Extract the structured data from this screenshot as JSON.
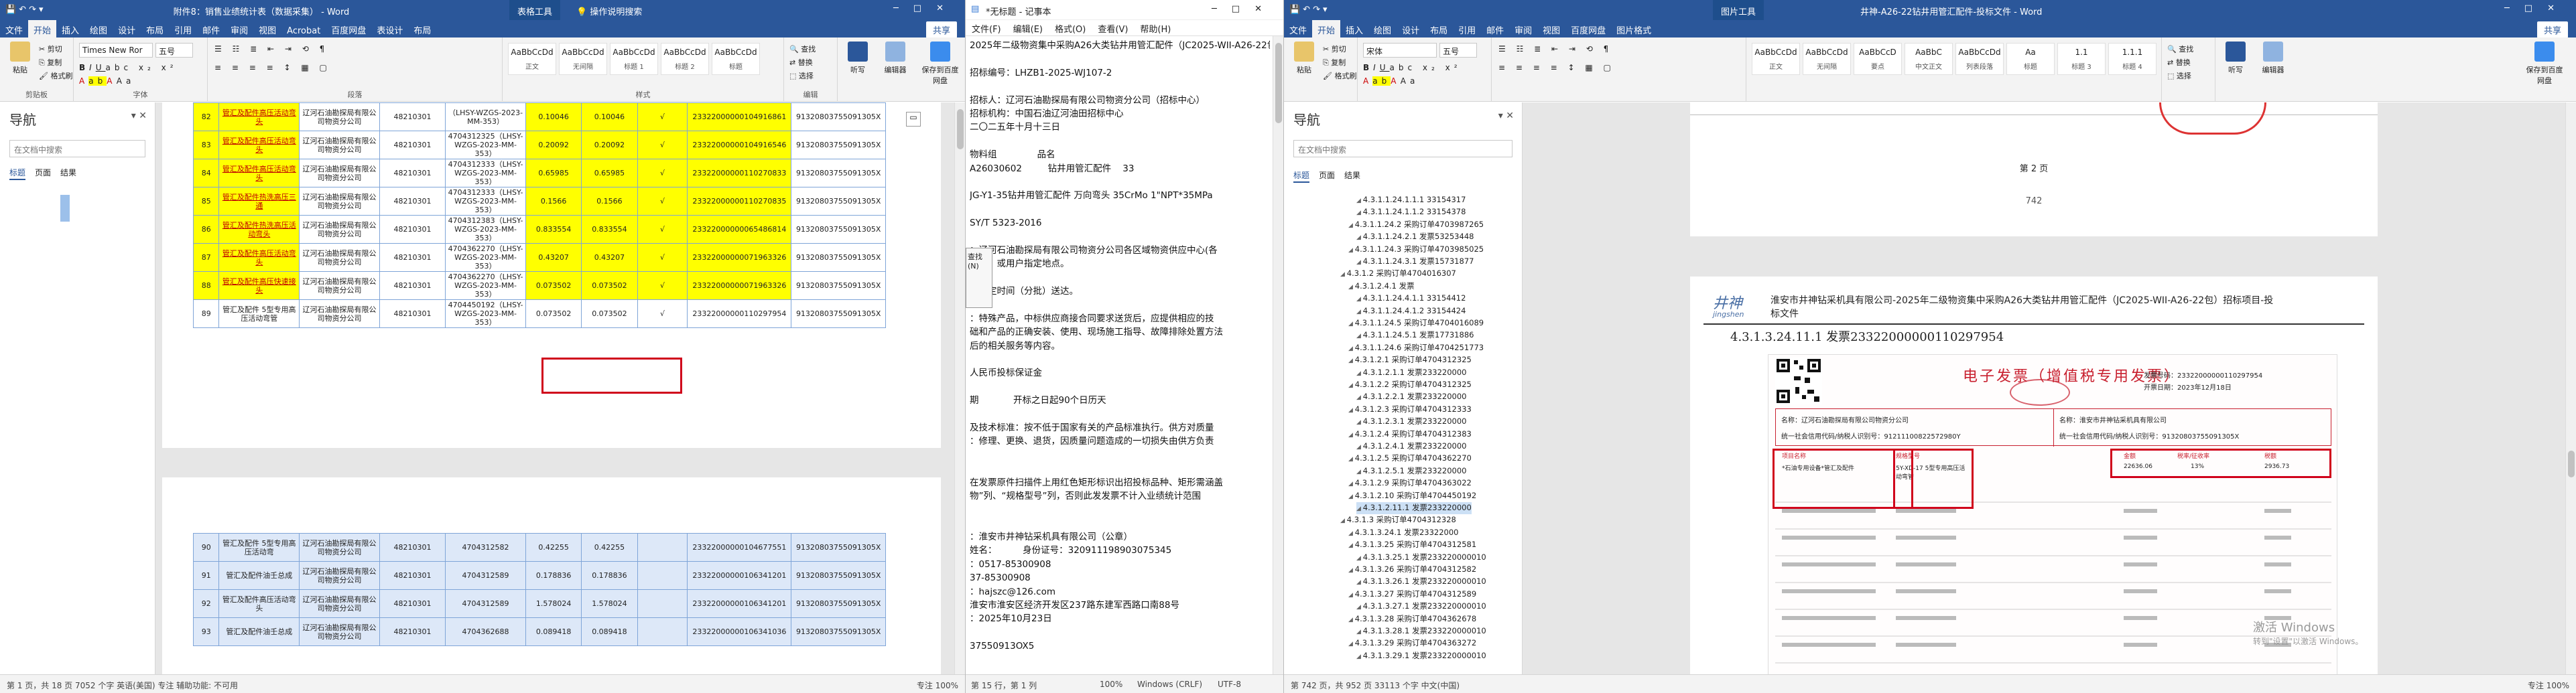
{
  "left_window": {
    "title": "附件8：销售业绩统计表（数据采集） - Word",
    "context_tab": "表格工具",
    "tell_me": "操作说明搜索",
    "share": "共享",
    "tabs": [
      "文件",
      "开始",
      "插入",
      "绘图",
      "设计",
      "布局",
      "引用",
      "邮件",
      "审阅",
      "视图",
      "Acrobat",
      "百度网盘",
      "表设计",
      "布局"
    ],
    "clipboard": {
      "paste": "粘贴",
      "cut": "剪切",
      "copy": "复制",
      "format_painter": "格式刷",
      "label": "剪贴板"
    },
    "font_name": "Times New Ror",
    "font_size": "五号",
    "font_label": "字体",
    "paragraph_label": "段落",
    "styles": [
      {
        "preview": "AaBbCcDd",
        "name": "正文"
      },
      {
        "preview": "AaBbCcDd",
        "name": "无间隔"
      },
      {
        "preview": "AaBbCcDd",
        "name": "标题 1"
      },
      {
        "preview": "AaBbCcDd",
        "name": "标题 2"
      },
      {
        "preview": "AaBbCcDd",
        "name": "标题"
      }
    ],
    "styles_label": "样式",
    "editing": {
      "find": "查找",
      "replace": "替换",
      "select": "选择",
      "label": "编辑"
    },
    "buttons": {
      "dictation": "听写",
      "label_voice": "语音",
      "editor": "编辑器",
      "sensitivity": "灵敏度",
      "save_baidu": "保存到百度网盘"
    },
    "nav": {
      "title": "导航",
      "search_placeholder": "在文档中搜索",
      "tabs": [
        "标题",
        "页面",
        "结果"
      ]
    },
    "table_rows": [
      {
        "no": "82",
        "name": "管汇及配件高压活动弯头",
        "org": "辽河石油勘探局有限公司物资分公司",
        "code": "48210301",
        "contract": "（LHSY-WZGS-2023-MM-353）",
        "p1": "0.10046",
        "p2": "0.10046",
        "mark": "√",
        "inv": "23322000000104916861",
        "tax": "91320803755091305X"
      },
      {
        "no": "83",
        "name": "管汇及配件高压活动弯头",
        "org": "辽河石油勘探局有限公司物资分公司",
        "code": "48210301",
        "contract": "4704312325（LHSY-WZGS-2023-MM-353）",
        "p1": "0.20092",
        "p2": "0.20092",
        "mark": "√",
        "inv": "23322000000104916546",
        "tax": "91320803755091305X"
      },
      {
        "no": "84",
        "name": "管汇及配件高压活动弯头",
        "org": "辽河石油勘探局有限公司物资分公司",
        "code": "48210301",
        "contract": "4704312333（LHSY-WZGS-2023-MM-353）",
        "p1": "0.65985",
        "p2": "0.65985",
        "mark": "√",
        "inv": "23322000000110270833",
        "tax": "91320803755091305X"
      },
      {
        "no": "85",
        "name": "管汇及配件热洗高压三通",
        "org": "辽河石油勘探局有限公司物资分公司",
        "code": "48210301",
        "contract": "4704312333（LHSY-WZGS-2023-MM-353）",
        "p1": "0.1566",
        "p2": "0.1566",
        "mark": "√",
        "inv": "23322000000110270835",
        "tax": "91320803755091305X"
      },
      {
        "no": "86",
        "name": "管汇及配件热洗高压活动弯头",
        "org": "辽河石油勘探局有限公司物资分公司",
        "code": "48210301",
        "contract": "4704312383（LHSY-WZGS-2023-MM-353）",
        "p1": "0.833554",
        "p2": "0.833554",
        "mark": "√",
        "inv": "23322000000065486814",
        "tax": "91320803755091305X"
      },
      {
        "no": "87",
        "name": "管汇及配件高压活动弯头",
        "org": "辽河石油勘探局有限公司物资分公司",
        "code": "48210301",
        "contract": "4704362270（LHSY-WZGS-2023-MM-353）",
        "p1": "0.43207",
        "p2": "0.43207",
        "mark": "√",
        "inv": "23322000000071963326",
        "tax": "91320803755091305X"
      },
      {
        "no": "88",
        "name": "管汇及配件高压快速接头",
        "org": "辽河石油勘探局有限公司物资分公司",
        "code": "48210301",
        "contract": "4704362270（LHSY-WZGS-2023-MM-353）",
        "p1": "0.073502",
        "p2": "0.073502",
        "mark": "√",
        "inv": "23322000000071963326",
        "tax": "91320803755091305X"
      },
      {
        "no": "89",
        "name": "管汇及配件 5型专用高压活动弯管",
        "org": "辽河石油勘探局有限公司物资分公司",
        "code": "48210301",
        "contract": "4704450192（LHSY-WZGS-2023-MM-353）",
        "p1": "0.073502",
        "p2": "0.073502",
        "mark": "√",
        "inv": "23322000000110297954",
        "tax": "91320803755091305X"
      }
    ],
    "table_rows2": [
      {
        "no": "90",
        "name": "管汇及配件 5型专用高压活动弯",
        "org": "辽河石油勘探局有限公司物资分公司",
        "code": "48210301",
        "contract": "4704312582",
        "p1": "0.42255",
        "p2": "0.42255",
        "inv": "23322000000104677551",
        "tax": "91320803755091305X"
      },
      {
        "no": "91",
        "name": "管汇及配件油壬总成",
        "org": "辽河石油勘探局有限公司物资分公司",
        "code": "48210301",
        "contract": "4704312589",
        "p1": "0.178836",
        "p2": "0.178836",
        "inv": "23322000000106341201",
        "tax": "91320803755091305X"
      },
      {
        "no": "92",
        "name": "管汇及配件高压活动弯头",
        "org": "辽河石油勘探局有限公司物资分公司",
        "code": "48210301",
        "contract": "4704312589",
        "p1": "1.578024",
        "p2": "1.578024",
        "inv": "23322000000106341201",
        "tax": "91320803755091305X"
      },
      {
        "no": "93",
        "name": "管汇及配件油壬总成",
        "org": "辽河石油勘探局有限公司物资分公司",
        "code": "48210301",
        "contract": "4704362688",
        "p1": "0.089418",
        "p2": "0.089418",
        "inv": "23322000000106341036",
        "tax": "91320803755091305X"
      }
    ],
    "status": {
      "left": "第 1 页，共 18 页    7052 个字    英语(美国)",
      "left2": "专注  辅助功能: 不可用",
      "right": "专注    100%"
    }
  },
  "notepad": {
    "title": "*无标题 - 记事本",
    "menu": [
      "文件(F)",
      "编辑(E)",
      "格式(O)",
      "查看(V)",
      "帮助(H)"
    ],
    "lines": [
      "2025年二级物资集中采购A26大类钻井用管汇配件（JC2025-WII-A26-22包）二包",
      "",
      "招标编号：LHZB1-2025-WJ107-2",
      "",
      "招标人：辽河石油勘探局有限公司物资分公司（招标中心）",
      "招标机构：中国石油辽河油田招标中心",
      "二〇二五年十月十三日",
      "",
      "物料组              品名",
      "A26030602         钻井用管汇配件    33",
      "",
      "JG-Y1-35钻井用管汇配件 万向弯头 35CrMo 1\"NPT*35MPa",
      "",
      "SY/T 5323-2016",
      "",
      "：辽河石油勘探局有限公司物资分公司各区域物资供应中心(各",
      "公司）或用户指定地点。",
      "",
      "按指定时间（分批）送达。",
      "",
      "：特殊产品，中标供应商接合同要求送货后，应提供相应的技",
      "础和产品的正确安装、使用、现场施工指导、故障排除处置方法",
      "后的相关服务等内容。",
      "",
      "人民币投标保证金",
      "",
      "期            开标之日起90个日历天",
      "",
      "及技术标准：按不低于国家有关的产品标准执行。供方对质量",
      "：修理、更换、退货，因质量问题造成的一切损失由供方负责",
      "",
      "",
      "在发票原件扫描件上用红色矩形标识出招投标品种、矩形需涵盖",
      "物”列、“规格型号”列，否则此发发票不计入业绩统计范围",
      "",
      "",
      "：淮安市井神钻采机具有限公司（公章）",
      "姓名：         身份证号：320911198903075345",
      "：0517-85300908",
      "37-85300908",
      "：hajszc@126.com",
      "淮安市淮安区经济开发区237路东建军西路口南88号",
      "：2025年10月23日",
      "",
      "37550913OX5"
    ],
    "status": {
      "pos": "第 15 行，第 1 列",
      "zoom": "100%",
      "eol": "Windows (CRLF)",
      "enc": "UTF-8"
    },
    "find_fragment": "查找(N)"
  },
  "right_window": {
    "title": "井神-A26-22钻井用管汇配件-投标文件 - Word",
    "context_tab": "图片工具",
    "share": "共享",
    "tabs": [
      "文件",
      "开始",
      "插入",
      "绘图",
      "设计",
      "布局",
      "引用",
      "邮件",
      "审阅",
      "视图",
      "百度网盘",
      "图片格式"
    ],
    "font_name": "宋体",
    "font_size": "五号",
    "styles": [
      {
        "preview": "AaBbCcDd",
        "name": "正文"
      },
      {
        "preview": "AaBbCcDd",
        "name": "无间隔"
      },
      {
        "preview": "AaBbCcD",
        "name": "要点"
      },
      {
        "preview": "AaBbC",
        "name": "中文正文"
      },
      {
        "preview": "AaBbCcDd",
        "name": "列表段落"
      },
      {
        "preview": "Aa",
        "name": "标题"
      },
      {
        "preview": "1.1",
        "name": "标题 3"
      },
      {
        "preview": "1.1.1",
        "name": "标题 4"
      }
    ],
    "nav": {
      "title": "导航",
      "search_placeholder": "在文档中搜索",
      "tabs": [
        "标题",
        "页面",
        "结果"
      ]
    },
    "outline": [
      {
        "t": "4.3.1.1.24.1.1.1 33154317",
        "d": 4
      },
      {
        "t": "4.3.1.1.24.1.1.2 33154378",
        "d": 4
      },
      {
        "t": "4.3.1.1.24.2 采购订单4703987265",
        "d": 3
      },
      {
        "t": "4.3.1.1.24.2.1 发票53253448",
        "d": 4
      },
      {
        "t": "4.3.1.1.24.3 采购订单4703985025",
        "d": 3
      },
      {
        "t": "4.3.1.1.24.3.1 发票15731877",
        "d": 4
      },
      {
        "t": "4.3.1.2 采购订单4704016307",
        "d": 2
      },
      {
        "t": "4.3.1.2.4.1 发票",
        "d": 3
      },
      {
        "t": "4.3.1.1.24.4.1.1 33154412",
        "d": 4
      },
      {
        "t": "4.3.1.1.24.4.1.2 33154424",
        "d": 4
      },
      {
        "t": "4.3.1.1.24.5 采购订单4704016089",
        "d": 3
      },
      {
        "t": "4.3.1.1.24.5.1 发票17731886",
        "d": 4
      },
      {
        "t": "4.3.1.1.24.6 采购订单4704251773",
        "d": 3
      },
      {
        "t": "4.3.1.2.1 采购订单4704312325",
        "d": 3
      },
      {
        "t": "4.3.1.2.1.1 发票233220000",
        "d": 4
      },
      {
        "t": "4.3.1.2.2 采购订单4704312325",
        "d": 3
      },
      {
        "t": "4.3.1.2.2.1 发票233220000",
        "d": 4
      },
      {
        "t": "4.3.1.2.3 采购订单4704312333",
        "d": 3
      },
      {
        "t": "4.3.1.2.3.1 发票233220000",
        "d": 4
      },
      {
        "t": "4.3.1.2.4 采购订单4704312383",
        "d": 3
      },
      {
        "t": "4.3.1.2.4.1 发票233220000",
        "d": 4
      },
      {
        "t": "4.3.1.2.5 采购订单4704362270",
        "d": 3
      },
      {
        "t": "4.3.1.2.5.1 发票233220000",
        "d": 4
      },
      {
        "t": "4.3.1.2.9 采购订单4704363022",
        "d": 3
      },
      {
        "t": "4.3.1.2.10 采购订单4704450192",
        "d": 3
      },
      {
        "t": "4.3.1.2.11.1 发票233220000",
        "d": 4,
        "sel": true
      },
      {
        "t": "4.3.1.3 采购订单4704312328",
        "d": 2
      },
      {
        "t": "4.3.1.3.24.1 发票23322000",
        "d": 3
      },
      {
        "t": "4.3.1.3.25 采购订单4704312581",
        "d": 3
      },
      {
        "t": "4.3.1.3.25.1 发票233220000010",
        "d": 4
      },
      {
        "t": "4.3.1.3.26 采购订单4704312582",
        "d": 3
      },
      {
        "t": "4.3.1.3.26.1 发票233220000010",
        "d": 4
      },
      {
        "t": "4.3.1.3.27 采购订单4704312589",
        "d": 3
      },
      {
        "t": "4.3.1.3.27.1 发票233220000010",
        "d": 4
      },
      {
        "t": "4.3.1.3.28 采购订单4704362678",
        "d": 3
      },
      {
        "t": "4.3.1.3.28.1 发票233220000010",
        "d": 4
      },
      {
        "t": "4.3.1.3.29 采购订单4704363272",
        "d": 3
      },
      {
        "t": "4.3.1.3.29.1 发票233220000010",
        "d": 4
      }
    ],
    "page2_label": "第 2 页",
    "page_number": "742",
    "doc_header_logo": "井神",
    "doc_header_logo_sub": "jingshen",
    "doc_header_text": "淮安市井神钻采机具有限公司-2025年二级物资集中采购A26大类钻井用管汇配件（JC2025-WII-A26-22包）招标项目-投标文件",
    "heading": "4.3.1.3.24.11.1 发票23322000000110297954",
    "invoice": {
      "title": "电子发票（增值税专用发票）",
      "no_label": "发票号码：",
      "no": "23322000000110297954",
      "date_label": "开票日期：",
      "date": "2023年12月18日",
      "buyer": "名称：辽河石油勘探局有限公司物资分公司",
      "buyer_tax": "统一社会信用代码/纳税人识别号：91211100822572980Y",
      "seller": "名称：淮安市井神钻采机具有限公司",
      "seller_tax": "统一社会信用代码/纳税人识别号：91320803755091305X",
      "item_header": "项目名称",
      "spec_header": "规格型号",
      "amount_header": "金额",
      "rate_header": "税率/征收率",
      "tax_header": "税额",
      "first_item": "*石油专用设备*管汇及配件",
      "first_spec": "5Y-XD-17 5型专用高压活动弯管",
      "first_amount": "22636.06",
      "first_rate": "13%",
      "first_tax": "2936.73"
    },
    "watermark1": "激活 Windows",
    "watermark2": "转到\"设置\"以激活 Windows。",
    "status": {
      "left": "第 742 页，共 952 页    33113 个字    中文(中国)",
      "right": "专注        100%"
    }
  },
  "colors": {
    "word_blue": "#2b579a",
    "highlight_yellow": "#ffff00",
    "table_border": "#7fa5d8",
    "red_box": "#d0021b",
    "invoice_red": "#c8202f"
  }
}
